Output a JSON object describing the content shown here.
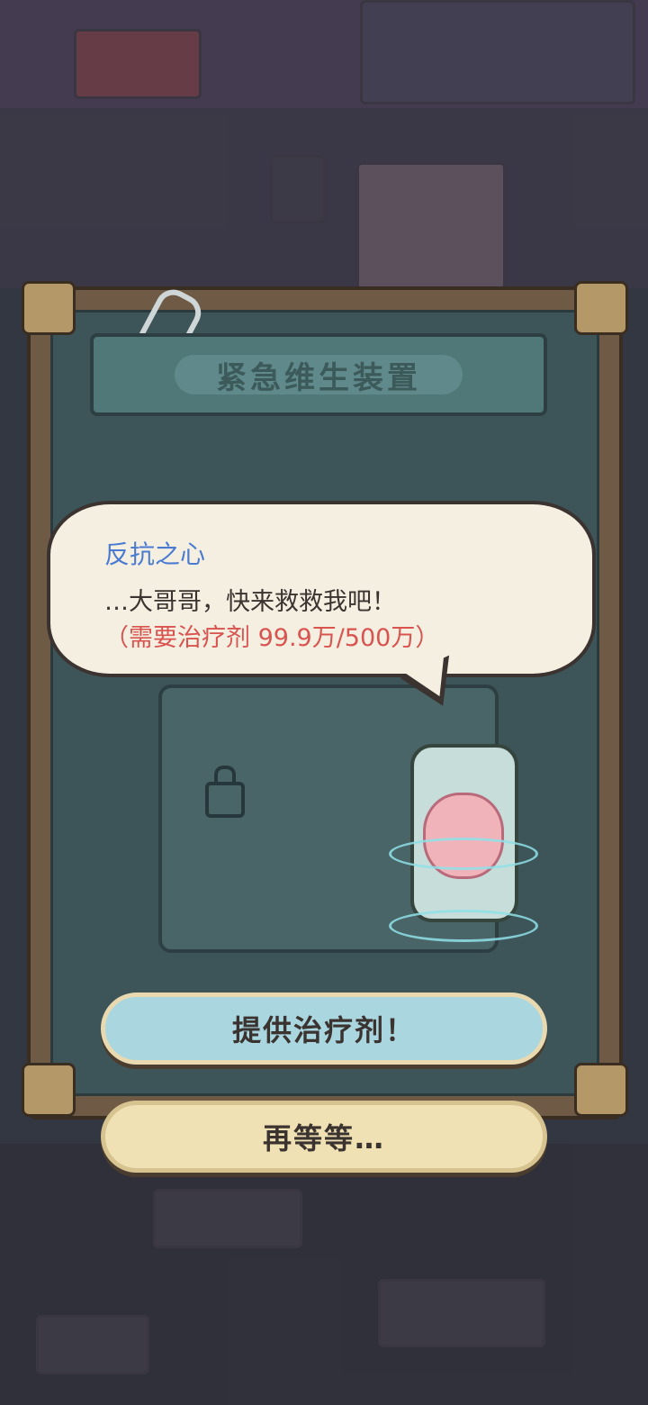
{
  "dialog": {
    "title": "紧急维生装置",
    "speaker": "反抗之心",
    "message": "…大哥哥，快来救救我吧！",
    "requirement": "（需要治疗剂  99.9万/500万）",
    "primary_button": "提供治疗剂！",
    "secondary_button": "再等等…"
  },
  "progress": {
    "current": 999000,
    "required": 5000000,
    "fraction": 0.1998
  },
  "colors": {
    "speaker": "#4b7bd0",
    "requirement": "#d9534f",
    "primary_button": "#a9d6df",
    "secondary_button": "#efe1b4"
  },
  "icons": [
    "paperclip-icon",
    "lock-icon",
    "brain-jar-icon",
    "alert-icon"
  ]
}
